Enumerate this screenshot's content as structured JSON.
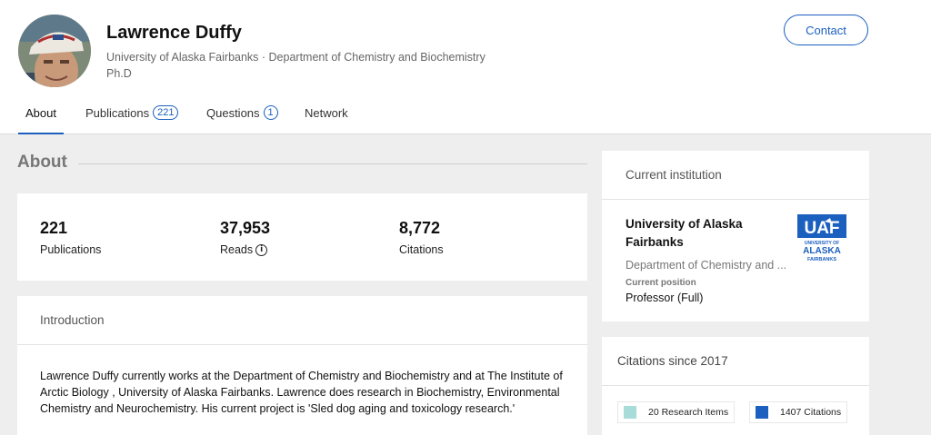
{
  "profile": {
    "name": "Lawrence Duffy",
    "affiliation": "University of Alaska Fairbanks · Department of Chemistry and Biochemistry",
    "degree": "Ph.D",
    "contact_label": "Contact"
  },
  "tabs": [
    {
      "label": "About",
      "active": true
    },
    {
      "label": "Publications",
      "count": "221"
    },
    {
      "label": "Questions",
      "count": "1"
    },
    {
      "label": "Network"
    }
  ],
  "about": {
    "section_title": "About",
    "stats": [
      {
        "value": "221",
        "label": "Publications"
      },
      {
        "value": "37,953",
        "label": "Reads",
        "icon": "info-icon"
      },
      {
        "value": "8,772",
        "label": "Citations"
      }
    ],
    "introduction": {
      "heading": "Introduction",
      "text": "Lawrence Duffy currently works at the Department of Chemistry and Biochemistry and at The Institute of Arctic Biology , University of Alaska Fairbanks. Lawrence does research in Biochemistry, Environmental Chemistry and Neurochemistry. His current project is 'Sled dog aging and toxicology research.'"
    }
  },
  "institution": {
    "heading": "Current institution",
    "name": "University of Alaska Fairbanks",
    "department": "Department of Chemistry and ...",
    "position_label": "Current position",
    "position": "Professor (Full)",
    "logo": {
      "text": "UAF",
      "line1": "UNIVERSITY OF",
      "line2": "ALASKA",
      "line3": "FAIRBANKS"
    }
  },
  "citations": {
    "heading": "Citations since 2017",
    "legend": [
      {
        "label": "20 Research Items",
        "color": "#a8dcd9"
      },
      {
        "label": "1407 Citations",
        "color": "#1b5fbf"
      }
    ]
  },
  "colors": {
    "accent": "#1b5fbf"
  }
}
